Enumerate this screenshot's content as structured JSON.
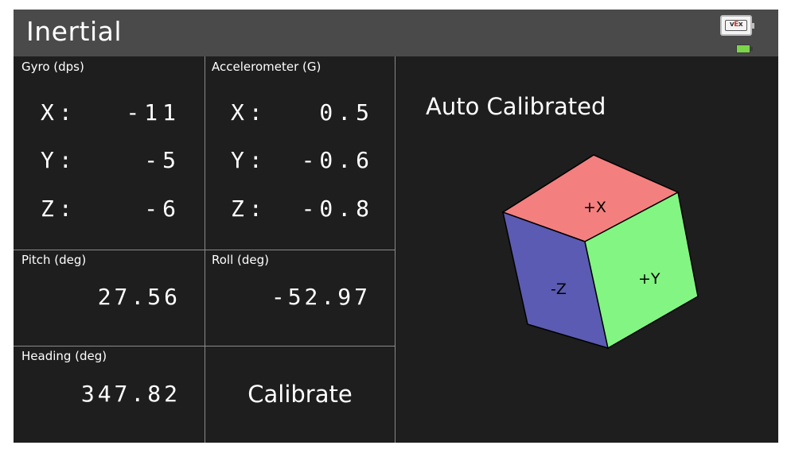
{
  "title": "Inertial",
  "gyro": {
    "label": "Gyro (dps)",
    "rows": [
      {
        "axis": "X:",
        "value": "-11"
      },
      {
        "axis": "Y:",
        "value": "-5"
      },
      {
        "axis": "Z:",
        "value": "-6"
      }
    ]
  },
  "accelerometer": {
    "label": "Accelerometer (G)",
    "rows": [
      {
        "axis": "X:",
        "value": "0.5"
      },
      {
        "axis": "Y:",
        "value": "-0.6"
      },
      {
        "axis": "Z:",
        "value": "-0.8"
      }
    ]
  },
  "pitch": {
    "label": "Pitch (deg)",
    "value": "27.56"
  },
  "roll": {
    "label": "Roll (deg)",
    "value": "-52.97"
  },
  "heading": {
    "label": "Heading (deg)",
    "value": "347.82"
  },
  "calibrate_label": "Calibrate",
  "status": "Auto Calibrated",
  "cube": {
    "top_label": "+X",
    "left_label": "-Z",
    "right_label": "+Y",
    "colors": {
      "top": "#f47f7f",
      "left": "#5b5bb3",
      "right": "#82f582"
    }
  },
  "icons": {
    "logo": "vex-logo-icon",
    "battery": "battery-icon"
  },
  "colors": {
    "background": "#1e1e1e",
    "titlebar": "#4a4a4a",
    "grid_lines": "#8a8a8a",
    "battery": "#7bd64a"
  }
}
